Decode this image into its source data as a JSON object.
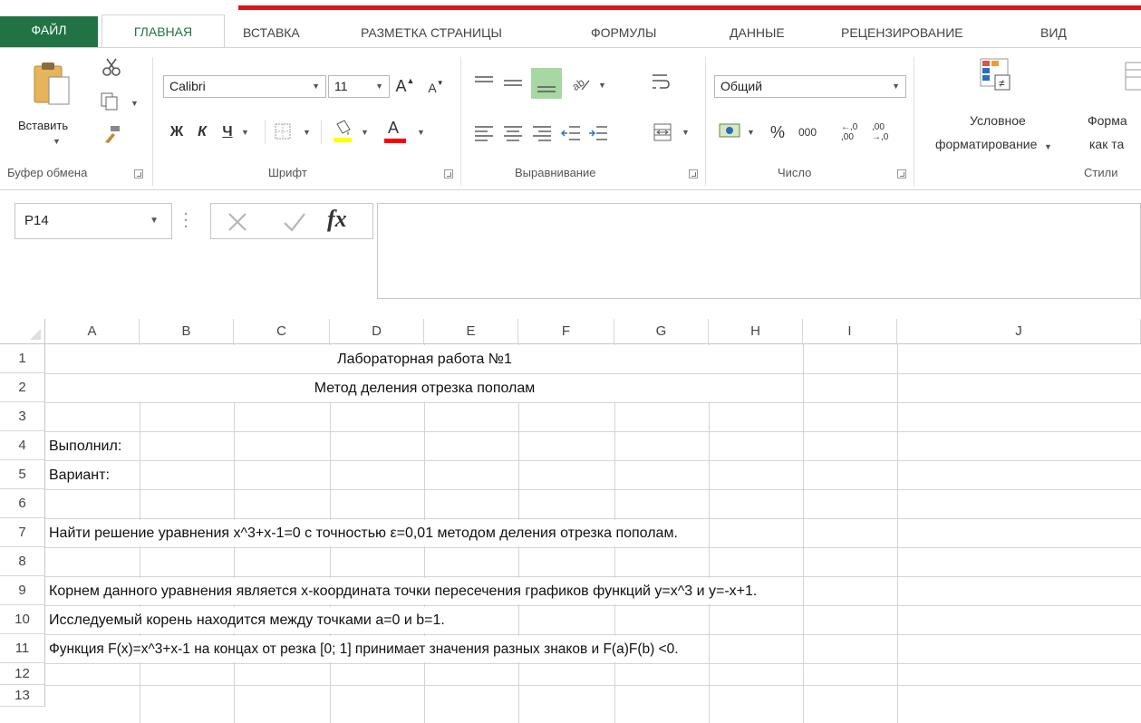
{
  "ribbon_tabs": [
    "ФАЙЛ",
    "ГЛАВНАЯ",
    "ВСТАВКА",
    "РАЗМЕТКА СТРАНИЦЫ",
    "ФОРМУЛЫ",
    "ДАННЫЕ",
    "РЕЦЕНЗИРОВАНИЕ",
    "ВИД"
  ],
  "clipboard": {
    "paste_label": "Вставить",
    "group_label": "Буфер обмена"
  },
  "font": {
    "name": "Calibri",
    "size": "11",
    "bold": "Ж",
    "italic": "К",
    "underline": "Ч",
    "grow": "A",
    "shrink": "A",
    "font_color_letter": "A",
    "group_label": "Шрифт"
  },
  "alignment": {
    "group_label": "Выравнивание"
  },
  "number": {
    "format": "Общий",
    "percent": "%",
    "thousands": "000",
    "inc_decimal": "←,0 ,00",
    "dec_decimal": ",00 →,0",
    "group_label": "Число"
  },
  "styles": {
    "conditional_line1": "Условное",
    "conditional_line2": "форматирование",
    "format_table_line1": "Форма",
    "format_table_line2": "как та",
    "group_label": "Стили"
  },
  "formula_bar": {
    "name_box": "P14",
    "fx": "fx",
    "value": ""
  },
  "columns": [
    "A",
    "B",
    "C",
    "D",
    "E",
    "F",
    "G",
    "H",
    "I",
    "J"
  ],
  "rows": [
    "1",
    "2",
    "3",
    "4",
    "5",
    "6",
    "7",
    "8",
    "9",
    "10",
    "11",
    "12",
    "13"
  ],
  "cells": {
    "r1": "Лабораторная работа №1",
    "r2": "Метод деления отрезка пополам",
    "r4": "Выполнил:",
    "r5": "Вариант:",
    "r7": "Найти решение уравнения x^3+x-1=0 с точностью ε=0,01 методом деления отрезка пополам.",
    "r9": " Корнем данного уравнения является x-координата точки пересечения графиков функций y=x^3 и y=-x+1.",
    "r10": " Исследуемый корень находится между точками a=0 и b=1.",
    "r11": "Функция F(x)=x^3+x-1 на концах от резка [0; 1] принимает значения разных знаков и  F(a)F(b) <0."
  },
  "colors": {
    "excel_green": "#217346",
    "accent_red": "#d9151b",
    "highlight_yellow": "#ffff00",
    "font_red": "#ff0000"
  }
}
